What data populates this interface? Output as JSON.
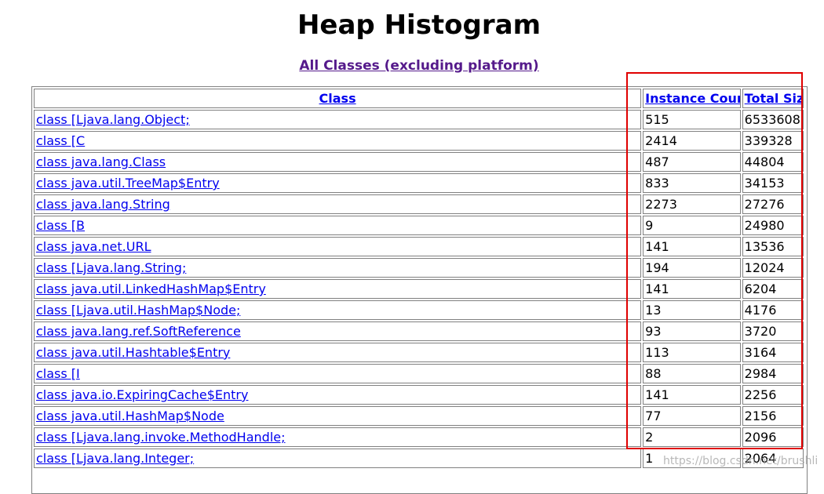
{
  "page": {
    "title": "Heap Histogram",
    "subtitle_link": "All Classes (excluding platform)"
  },
  "table": {
    "headers": {
      "class": "Class",
      "instance_count": "Instance Count",
      "total_size": "Total Size"
    },
    "rows": [
      {
        "class": "class [Ljava.lang.Object;",
        "count": "515",
        "size": "6533608"
      },
      {
        "class": "class [C",
        "count": "2414",
        "size": "339328"
      },
      {
        "class": "class java.lang.Class",
        "count": "487",
        "size": "44804"
      },
      {
        "class": "class java.util.TreeMap$Entry",
        "count": "833",
        "size": "34153"
      },
      {
        "class": "class java.lang.String",
        "count": "2273",
        "size": "27276"
      },
      {
        "class": "class [B",
        "count": "9",
        "size": "24980"
      },
      {
        "class": "class java.net.URL",
        "count": "141",
        "size": "13536"
      },
      {
        "class": "class [Ljava.lang.String;",
        "count": "194",
        "size": "12024"
      },
      {
        "class": "class java.util.LinkedHashMap$Entry",
        "count": "141",
        "size": "6204"
      },
      {
        "class": "class [Ljava.util.HashMap$Node;",
        "count": "13",
        "size": "4176"
      },
      {
        "class": "class java.lang.ref.SoftReference",
        "count": "93",
        "size": "3720"
      },
      {
        "class": "class java.util.Hashtable$Entry",
        "count": "113",
        "size": "3164"
      },
      {
        "class": "class [I",
        "count": "88",
        "size": "2984"
      },
      {
        "class": "class java.io.ExpiringCache$Entry",
        "count": "141",
        "size": "2256"
      },
      {
        "class": "class java.util.HashMap$Node",
        "count": "77",
        "size": "2156"
      },
      {
        "class": "class [Ljava.lang.invoke.MethodHandle;",
        "count": "2",
        "size": "2096"
      },
      {
        "class": "class [Ljava.lang.Integer;",
        "count": "1",
        "size": "2064"
      }
    ]
  },
  "watermark": "https://blog.csdn.net/brushli",
  "colors": {
    "link": "#0000ee",
    "visited_link": "#551a8b",
    "highlight_box": "#e00000",
    "cell_border": "#808080"
  }
}
